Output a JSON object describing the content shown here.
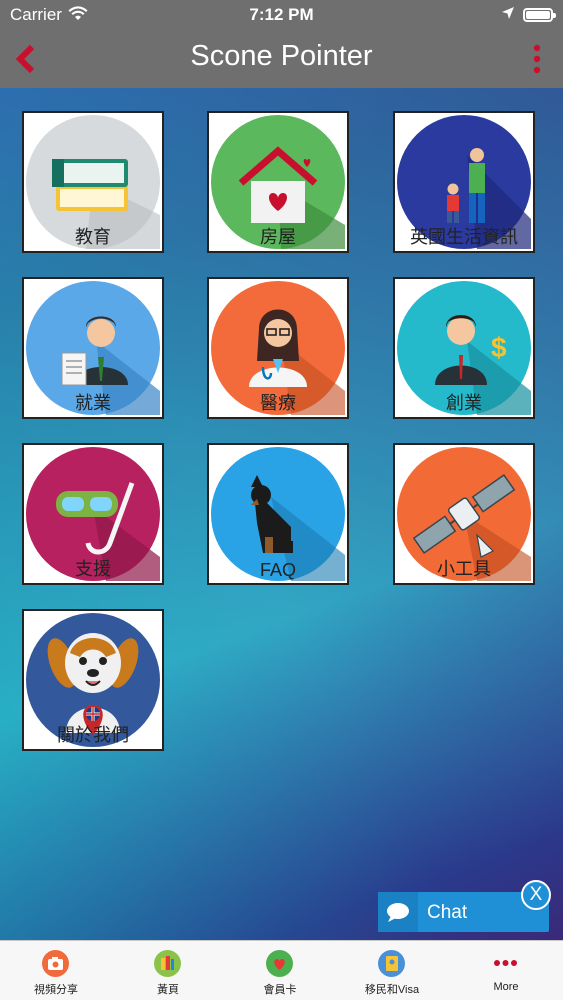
{
  "status_bar": {
    "carrier": "Carrier",
    "time": "7:12 PM"
  },
  "nav": {
    "title": "Scone Pointer",
    "back_icon": "chevron-left-icon",
    "menu_icon": "more-vertical-icon",
    "accent": "#c8102e"
  },
  "tiles": [
    {
      "label": "教育",
      "icon": "books-icon",
      "color": "#d6dadd"
    },
    {
      "label": "房屋",
      "icon": "house-icon",
      "color": "#5cb85c"
    },
    {
      "label": "英國生活資訊",
      "icon": "family-icon",
      "color": "#2b3a9e"
    },
    {
      "label": "就業",
      "icon": "job-seeker-icon",
      "color": "#5ba8e8"
    },
    {
      "label": "醫療",
      "icon": "doctor-icon",
      "color": "#f36b3a"
    },
    {
      "label": "創業",
      "icon": "businessman-icon",
      "color": "#25b9cc"
    },
    {
      "label": "支援",
      "icon": "snorkel-mask-icon",
      "color": "#b8215f"
    },
    {
      "label": "FAQ",
      "icon": "dog-icon",
      "color": "#29a3e6"
    },
    {
      "label": "小工具",
      "icon": "satellite-icon",
      "color": "#f26a36"
    },
    {
      "label": "關於我們",
      "icon": "mascot-dog-icon",
      "color": "#33599c"
    }
  ],
  "chat": {
    "label": "Chat",
    "close_label": "X",
    "icon": "chat-bubble-icon"
  },
  "tab_bar": [
    {
      "label": "視頻分享",
      "icon": "camera-icon",
      "color": "#f06a3c"
    },
    {
      "label": "黃頁",
      "icon": "yellow-pages-icon",
      "color": "#8bc34a"
    },
    {
      "label": "會員卡",
      "icon": "heart-card-icon",
      "color": "#4caf50"
    },
    {
      "label": "移民和Visa",
      "icon": "passport-icon",
      "color": "#4a90d9"
    },
    {
      "label": "More",
      "icon": "more-dots-icon",
      "color": "#c8102e"
    }
  ]
}
